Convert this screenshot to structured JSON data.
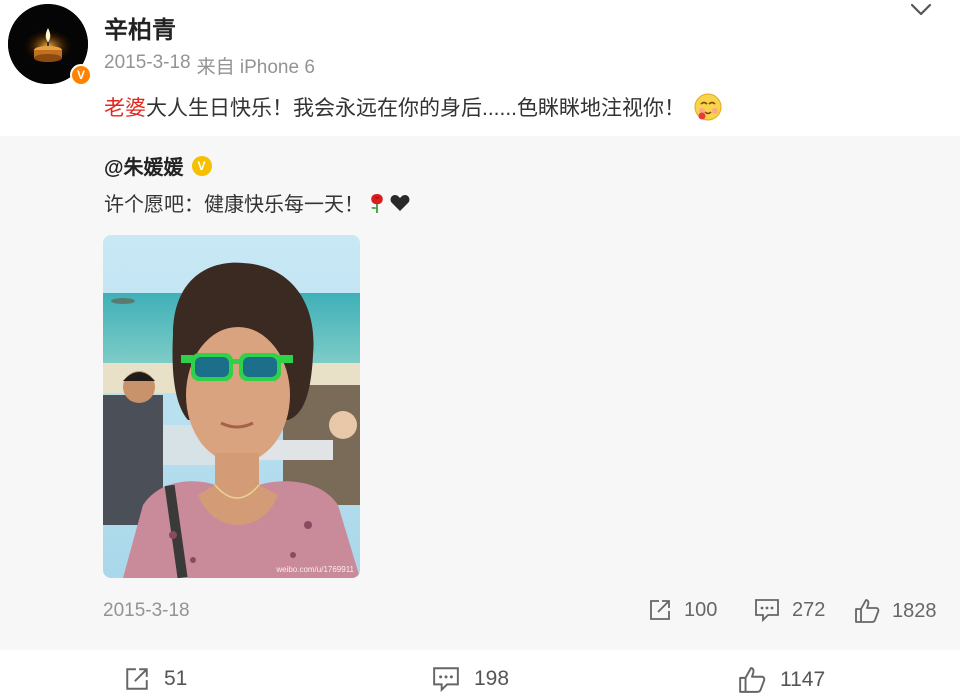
{
  "header": {
    "username": "辛柏青",
    "date": "2015-3-18",
    "source": "来自 iPhone 6",
    "verified_badge": "V"
  },
  "post": {
    "text_highlight": "老婆",
    "text_rest": "大人生日快乐！我会永远在你的身后......色眯眯地注视你！"
  },
  "retweet": {
    "user": "@朱媛媛",
    "verified_badge": "V",
    "text": "许个愿吧：健康快乐每一天！",
    "photo_watermark": "weibo.com/u/1769911",
    "date": "2015-3-18",
    "stats": {
      "reposts": "100",
      "comments": "272",
      "likes": "1828"
    }
  },
  "footer": {
    "reposts": "51",
    "comments": "198",
    "likes": "1147"
  },
  "colors": {
    "accent_red": "#e0281e",
    "verified_orange": "#ff8200",
    "verified_gold": "#f5c000",
    "muted": "#939393",
    "retweet_bg": "#f7f7f7"
  },
  "icons": {
    "chevron": "chevron-down-icon",
    "repost": "repost-icon",
    "comment": "comment-icon",
    "like": "thumbs-up-icon",
    "emoji": "lecherous-face-emoji-icon",
    "rose": "rose-icon",
    "heart": "black-heart-icon"
  }
}
